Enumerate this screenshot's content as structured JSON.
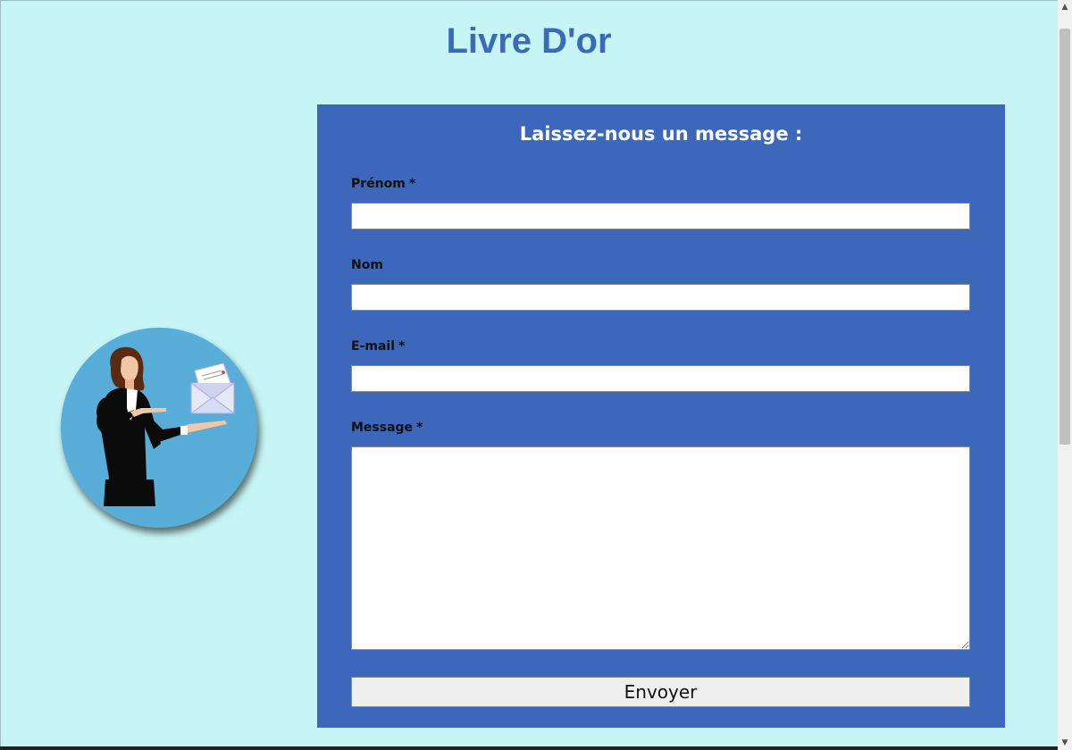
{
  "page": {
    "title": "Livre D'or"
  },
  "illustration": {
    "icon": "businesswoman-with-envelope"
  },
  "form": {
    "heading": "Laissez-nous un message :",
    "fields": {
      "prenom": {
        "label": "Prénom",
        "required_mark": "*",
        "value": ""
      },
      "nom": {
        "label": "Nom",
        "required_mark": "",
        "value": ""
      },
      "email": {
        "label": "E-mail",
        "required_mark": "*",
        "value": ""
      },
      "message": {
        "label": "Message",
        "required_mark": "*",
        "value": ""
      }
    },
    "submit_label": "Envoyer"
  },
  "scrollbar": {
    "up_icon": "chevron-up-icon",
    "down_icon": "chevron-down-icon"
  },
  "colors": {
    "page_background": "#c7f5f6",
    "title": "#3b6ab9",
    "form_background": "#3c67ba",
    "illustration_circle": "#58aed8"
  }
}
